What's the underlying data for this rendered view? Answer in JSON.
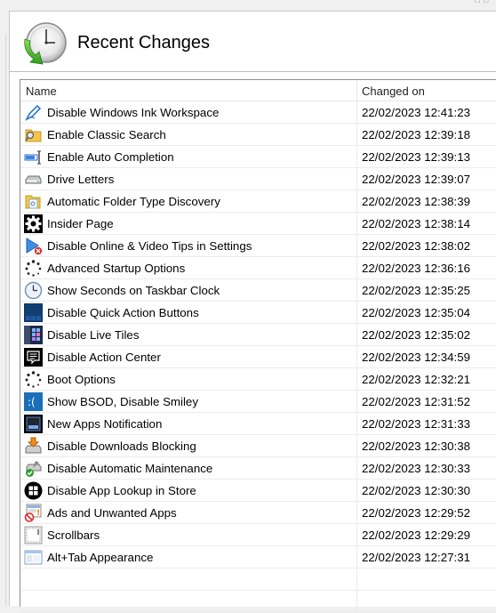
{
  "header": {
    "title": "Recent Changes",
    "icon": "clock-history-icon"
  },
  "columns": {
    "name": "Name",
    "changed_on": "Changed on"
  },
  "items": [
    {
      "name": "Disable Windows Ink Workspace",
      "changed": "22/02/2023 12:41:23",
      "icon": "pen-icon"
    },
    {
      "name": "Enable Classic Search",
      "changed": "22/02/2023 12:39:18",
      "icon": "folder-search-icon"
    },
    {
      "name": "Enable Auto Completion",
      "changed": "22/02/2023 12:39:13",
      "icon": "text-cursor-icon"
    },
    {
      "name": "Drive Letters",
      "changed": "22/02/2023 12:39:07",
      "icon": "drive-icon"
    },
    {
      "name": "Automatic Folder Type Discovery",
      "changed": "22/02/2023 12:38:39",
      "icon": "folder-document-icon"
    },
    {
      "name": "Insider Page",
      "changed": "22/02/2023 12:38:14",
      "icon": "gear-icon"
    },
    {
      "name": "Disable Online & Video Tips in Settings",
      "changed": "22/02/2023 12:38:02",
      "icon": "play-blocked-icon"
    },
    {
      "name": "Advanced Startup Options",
      "changed": "22/02/2023 12:36:16",
      "icon": "spinner-dots-icon"
    },
    {
      "name": "Show Seconds on Taskbar Clock",
      "changed": "22/02/2023 12:35:25",
      "icon": "clock-icon"
    },
    {
      "name": "Disable Quick Action Buttons",
      "changed": "22/02/2023 12:35:04",
      "icon": "quick-actions-icon"
    },
    {
      "name": "Disable Live Tiles",
      "changed": "22/02/2023 12:35:02",
      "icon": "live-tiles-icon"
    },
    {
      "name": "Disable Action Center",
      "changed": "22/02/2023 12:34:59",
      "icon": "action-center-icon"
    },
    {
      "name": "Boot Options",
      "changed": "22/02/2023 12:32:21",
      "icon": "spinner-dots-icon"
    },
    {
      "name": "Show BSOD, Disable Smiley",
      "changed": "22/02/2023 12:31:52",
      "icon": "bsod-smiley-icon"
    },
    {
      "name": "New Apps Notification",
      "changed": "22/02/2023 12:31:33",
      "icon": "app-notification-icon"
    },
    {
      "name": "Disable Downloads Blocking",
      "changed": "22/02/2023 12:30:38",
      "icon": "download-drive-icon"
    },
    {
      "name": "Disable Automatic Maintenance",
      "changed": "22/02/2023 12:30:33",
      "icon": "maintenance-check-icon"
    },
    {
      "name": "Disable App Lookup in Store",
      "changed": "22/02/2023 12:30:30",
      "icon": "windows-store-icon"
    },
    {
      "name": "Ads and Unwanted Apps",
      "changed": "22/02/2023 12:29:52",
      "icon": "ads-blocked-icon"
    },
    {
      "name": "Scrollbars",
      "changed": "22/02/2023 12:29:29",
      "icon": "scrollbar-icon"
    },
    {
      "name": "Alt+Tab Appearance",
      "changed": "22/02/2023 12:27:31",
      "icon": "alt-tab-window-icon"
    }
  ]
}
